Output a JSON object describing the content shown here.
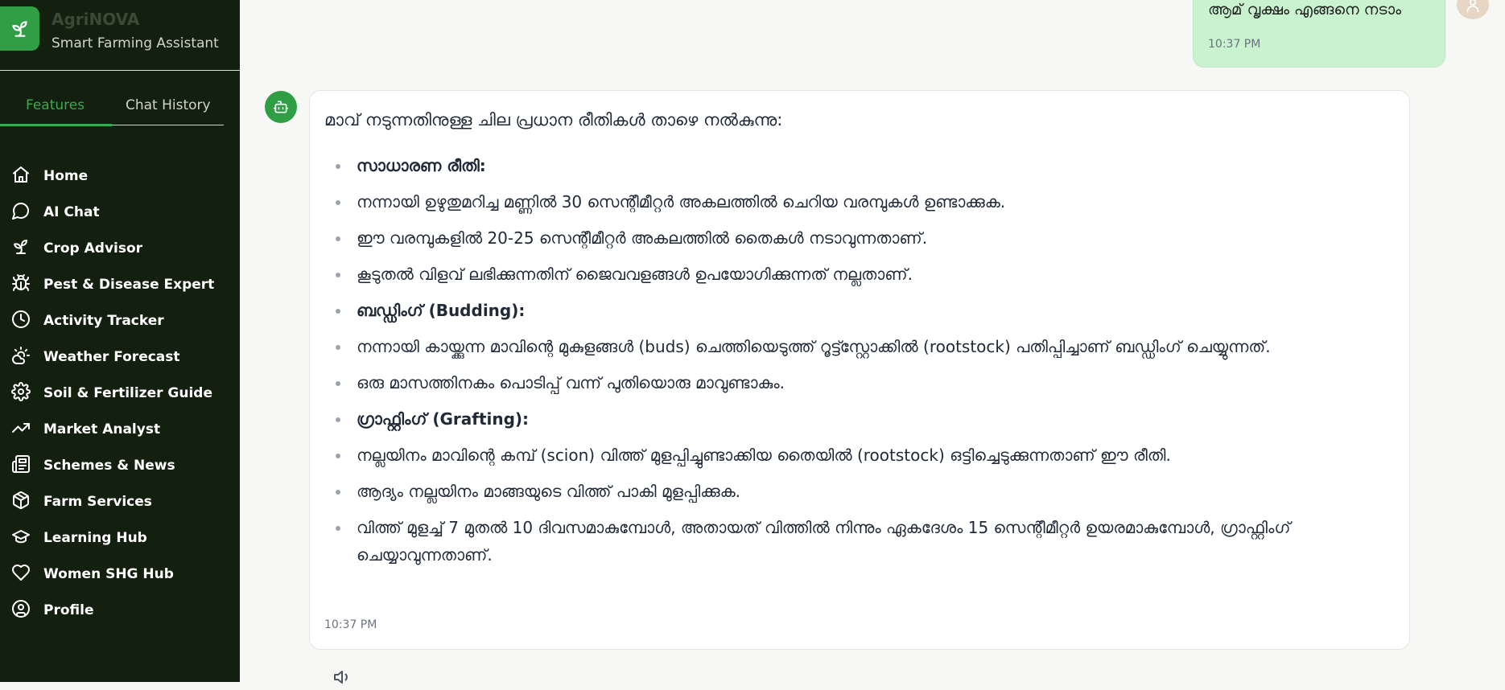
{
  "brand": {
    "title": "AgriNOVA",
    "subtitle": "Smart Farming Assistant"
  },
  "tabs": {
    "features": "Features",
    "history": "Chat History",
    "active": "features"
  },
  "nav": [
    {
      "label": "Home",
      "icon": "home-icon"
    },
    {
      "label": "AI Chat",
      "icon": "chat-bubble-icon"
    },
    {
      "label": "Crop Advisor",
      "icon": "sprout-icon"
    },
    {
      "label": "Pest & Disease Expert",
      "icon": "bug-icon"
    },
    {
      "label": "Activity Tracker",
      "icon": "clock-icon"
    },
    {
      "label": "Weather Forecast",
      "icon": "sun-cloud-icon"
    },
    {
      "label": "Soil & Fertilizer Guide",
      "icon": "gear-icon"
    },
    {
      "label": "Market Analyst",
      "icon": "trending-up-icon"
    },
    {
      "label": "Schemes & News",
      "icon": "newspaper-icon"
    },
    {
      "label": "Farm Services",
      "icon": "package-icon"
    },
    {
      "label": "Learning Hub",
      "icon": "graduation-cap-icon"
    },
    {
      "label": "Women SHG Hub",
      "icon": "heart-icon"
    },
    {
      "label": "Profile",
      "icon": "user-circle-icon"
    }
  ],
  "chat": {
    "user_message": {
      "text": "ആമ് വൃക്ഷം എങ്ങനെ നടാം",
      "time": "10:37 PM"
    },
    "bot_message": {
      "intro": "മാവ് നടുന്നതിനുള്ള ചില പ്രധാന രീതികൾ താഴെ നൽകുന്നു:",
      "items": [
        {
          "text": "സാധാരണ രീതി:",
          "bold": true
        },
        {
          "text": "നന്നായി ഉഴുതുമറിച്ച മണ്ണിൽ 30 സെന്റീമീറ്റർ അകലത്തിൽ ചെറിയ വരമ്പുകൾ ഉണ്ടാക്കുക.",
          "bold": false
        },
        {
          "text": "ഈ വരമ്പുകളിൽ 20-25 സെന്റീമീറ്റർ അകലത്തിൽ തൈകൾ നടാവുന്നതാണ്.",
          "bold": false
        },
        {
          "text": "കൂടുതൽ വിളവ് ലഭിക്കുന്നതിന് ജൈവവളങ്ങൾ ഉപയോഗിക്കുന്നത് നല്ലതാണ്.",
          "bold": false
        },
        {
          "text": "ബഡ്ഡിംഗ് (Budding):",
          "bold": true
        },
        {
          "text": "നന്നായി കായ്ക്കുന്ന മാവിന്റെ മുകുളങ്ങൾ (buds) ചെത്തിയെടുത്ത് റൂട്ട്സ്റ്റോക്കിൽ (rootstock) പതിപ്പിച്ചാണ് ബഡ്ഡിംഗ് ചെയ്യുന്നത്.",
          "bold": false
        },
        {
          "text": "ഒരു മാസത്തിനകം പൊടിപ്പ് വന്ന് പുതിയൊരു മാവുണ്ടാകും.",
          "bold": false
        },
        {
          "text": "ഗ്രാഫ്റ്റിംഗ് (Grafting):",
          "bold": true
        },
        {
          "text": "നല്ലയിനം മാവിന്റെ കമ്പ് (scion) വിത്ത് മുളപ്പിച്ചുണ്ടാക്കിയ തൈയിൽ (rootstock) ഒട്ടിച്ചെടുക്കുന്നതാണ് ഈ രീതി.",
          "bold": false
        },
        {
          "text": "ആദ്യം നല്ലയിനം മാങ്ങയുടെ വിത്ത് പാകി മുളപ്പിക്കുക.",
          "bold": false
        },
        {
          "text": "വിത്ത് മുളച്ച് 7 മുതൽ 10 ദിവസമാകുമ്പോൾ, അതായത് വിത്തിൽ നിന്നും ഏകദേശം 15 സെന്റീമീറ്റർ ഉയരമാകുമ്പോൾ, ഗ്രാഫ്റ്റിംഗ് ചെയ്യാവുന്നതാണ്.",
          "bold": false
        }
      ],
      "time": "10:37 PM"
    }
  },
  "colors": {
    "sidebar_bg": "#14200f",
    "accent": "#2f9e44",
    "user_bubble": "#c9f2cf"
  }
}
